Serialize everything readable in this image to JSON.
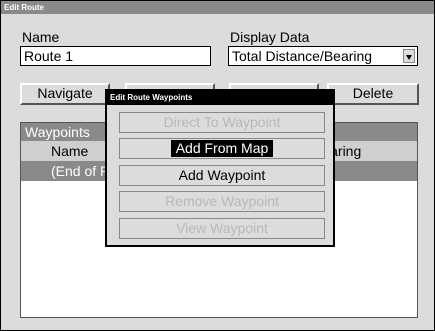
{
  "window": {
    "title": "Edit Route"
  },
  "name": {
    "label": "Name",
    "value": "Route 1"
  },
  "display_data": {
    "label": "Display Data",
    "value": "Total Distance/Bearing"
  },
  "buttons": {
    "navigate": "Navigate",
    "delete": "Delete"
  },
  "waypoints": {
    "title": "Waypoints",
    "columns": [
      "Name",
      "Bearing"
    ],
    "rows": [
      "(End of Route)"
    ]
  },
  "dialog": {
    "title": "Edit Route Waypoints",
    "items": [
      {
        "label": "Direct To Waypoint",
        "state": "disabled"
      },
      {
        "label": "Add From Map",
        "state": "selected"
      },
      {
        "label": "Add Waypoint",
        "state": "enabled"
      },
      {
        "label": "Remove Waypoint",
        "state": "disabled"
      },
      {
        "label": "View Waypoint",
        "state": "disabled"
      }
    ]
  },
  "colors": {
    "title_bar": "#8a8a8a",
    "dialog_title": "#000000",
    "disabled_text": "#b8b8b8",
    "selection": "#000000"
  }
}
